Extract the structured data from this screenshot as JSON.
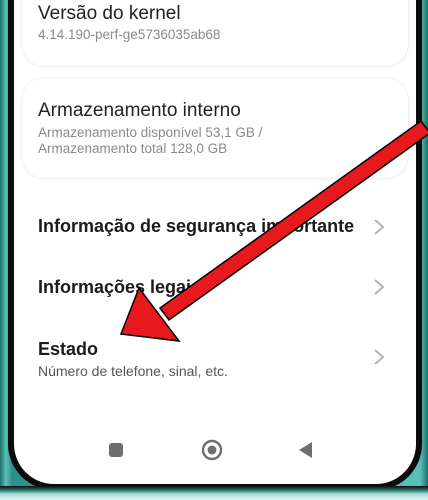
{
  "kernel": {
    "title": "Versão do kernel",
    "value": "4.14.190-perf-ge5736035ab68"
  },
  "storage": {
    "title": "Armazenamento interno",
    "line1": "Armazenamento disponível  53,1 GB /",
    "line2": "Armazenamento total  128,0 GB"
  },
  "rows": [
    {
      "title": "Informação de segurança importante",
      "subtitle": ""
    },
    {
      "title": "Informações legais",
      "subtitle": ""
    },
    {
      "title": "Estado",
      "subtitle": "Número de telefone, sinal, etc."
    }
  ],
  "navbar": {
    "buttons": [
      "square-icon",
      "circle-icon",
      "back-triangle-icon"
    ]
  },
  "colors": {
    "annotation_arrow": "#e8191c",
    "device_body": "#3fa9a0",
    "chevron": "#b5b5b5"
  }
}
